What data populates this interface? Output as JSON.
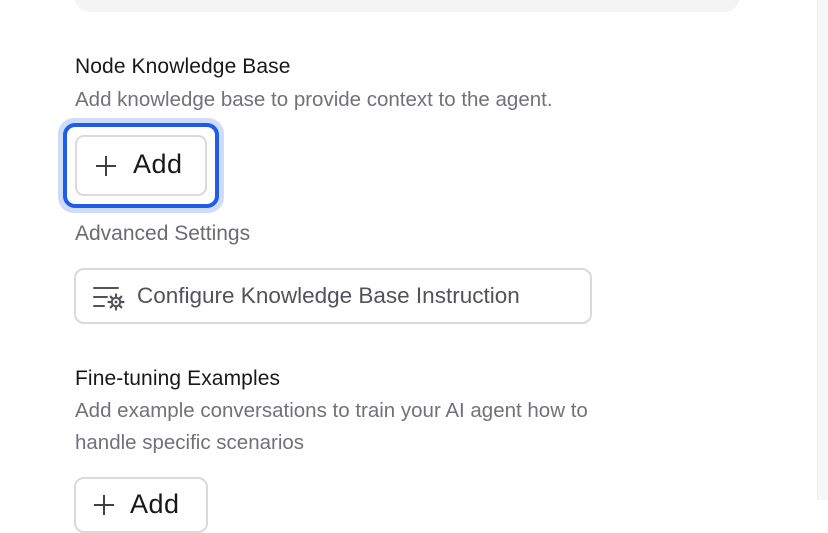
{
  "knowledge_base": {
    "title": "Node Knowledge Base",
    "description": "Add knowledge base to provide context to the agent.",
    "add_button_label": "Add"
  },
  "advanced_settings": {
    "title": "Advanced Settings",
    "configure_button_label": "Configure Knowledge Base Instruction",
    "configure_icon": "settings-list-icon"
  },
  "fine_tuning": {
    "title": "Fine-tuning Examples",
    "description_line1": "Add example conversations to train your AI agent how to",
    "description_line2": "handle specific scenarios",
    "add_button_label": "Add"
  },
  "colors": {
    "focus_ring": "#1f5ce8",
    "focus_halo": "#cfdcf9",
    "border": "#d9d9de",
    "heading_text": "#18181b",
    "muted_text": "#71717a"
  }
}
